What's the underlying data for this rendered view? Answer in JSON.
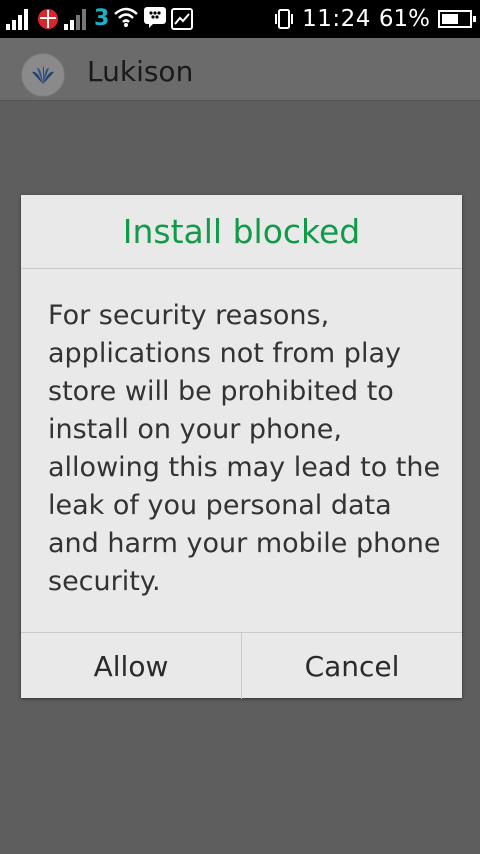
{
  "status_bar": {
    "time": "11:24",
    "battery_percent_text": "61%",
    "battery_level": 0.61,
    "icons": [
      "signal-icon",
      "red-app-icon",
      "signal-icon-2",
      "network-3-icon",
      "wifi-icon",
      "bbm-icon",
      "gallery-icon",
      "vibrate-icon",
      "battery-icon"
    ]
  },
  "app_bar": {
    "title": "Lukison",
    "logo_icon": "peacock-logo-icon"
  },
  "dialog": {
    "title": "Install blocked",
    "title_color": "#129a49",
    "message": "For security reasons, applications not from play store will be prohibited to install on your phone, allowing this may lead to the leak of you personal data and harm your mobile phone security.",
    "buttons": {
      "allow": "Allow",
      "cancel": "Cancel"
    }
  }
}
